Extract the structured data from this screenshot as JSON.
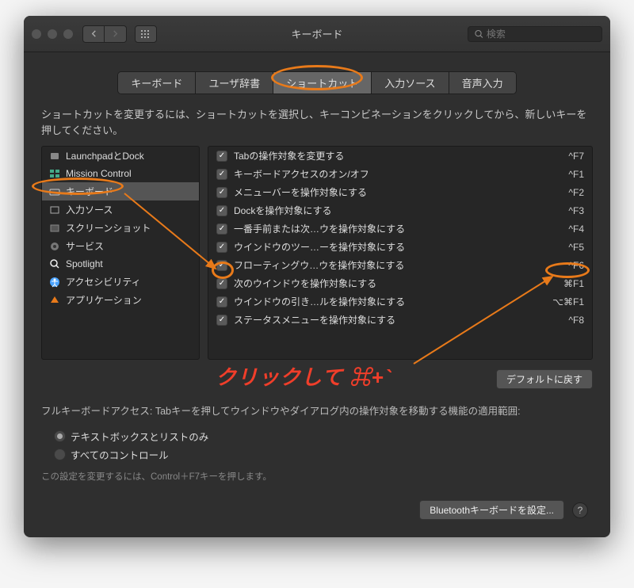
{
  "header": {
    "title": "キーボード",
    "search_placeholder": "検索"
  },
  "tabs": [
    {
      "label": "キーボード",
      "active": false
    },
    {
      "label": "ユーザ辞書",
      "active": false
    },
    {
      "label": "ショートカット",
      "active": true
    },
    {
      "label": "入力ソース",
      "active": false
    },
    {
      "label": "音声入力",
      "active": false
    }
  ],
  "instructions": "ショートカットを変更するには、ショートカットを選択し、キーコンビネーションをクリックしてから、新しいキーを押してください。",
  "categories": [
    {
      "label": "LaunchpadとDock",
      "icon": "rocket",
      "color": "#888"
    },
    {
      "label": "Mission Control",
      "icon": "mc",
      "color": "#5aa"
    },
    {
      "label": "キーボード",
      "icon": "keyboard",
      "color": "#ccc",
      "selected": true
    },
    {
      "label": "入力ソース",
      "icon": "input",
      "color": "#ccc"
    },
    {
      "label": "スクリーンショット",
      "icon": "screenshot",
      "color": "#888"
    },
    {
      "label": "サービス",
      "icon": "gear",
      "color": "#888"
    },
    {
      "label": "Spotlight",
      "icon": "spotlight",
      "color": "#eee"
    },
    {
      "label": "アクセシビリティ",
      "icon": "accessibility",
      "color": "#4aa3ff"
    },
    {
      "label": "アプリケーション",
      "icon": "app",
      "color": "#e87a1a"
    }
  ],
  "shortcuts": [
    {
      "checked": true,
      "label": "Tabの操作対象を変更する",
      "key": "^F7"
    },
    {
      "checked": true,
      "label": "キーボードアクセスのオン/オフ",
      "key": "^F1"
    },
    {
      "checked": true,
      "label": "メニューバーを操作対象にする",
      "key": "^F2"
    },
    {
      "checked": true,
      "label": "Dockを操作対象にする",
      "key": "^F3"
    },
    {
      "checked": true,
      "label": "一番手前または次…ウを操作対象にする",
      "key": "^F4"
    },
    {
      "checked": true,
      "label": "ウインドウのツー…ーを操作対象にする",
      "key": "^F5"
    },
    {
      "checked": true,
      "label": "フローティングウ…ウを操作対象にする",
      "key": "^F6"
    },
    {
      "checked": true,
      "label": "次のウインドウを操作対象にする",
      "key": "⌘F1",
      "highlight": true
    },
    {
      "checked": true,
      "label": "ウインドウの引き…ルを操作対象にする",
      "key": "⌥⌘F1"
    },
    {
      "checked": true,
      "label": "ステータスメニューを操作対象にする",
      "key": "^F8"
    }
  ],
  "restore_defaults_label": "デフォルトに戻す",
  "full_access_text": "フルキーボードアクセス: Tabキーを押してウインドウやダイアログ内の操作対象を移動する機能の適用範囲:",
  "radio_options": [
    {
      "label": "テキストボックスとリストのみ",
      "checked": true
    },
    {
      "label": "すべてのコントロール",
      "checked": false
    }
  ],
  "fine_print": "この設定を変更するには、Control＋F7キーを押します。",
  "bluetooth_label": "Bluetoothキーボードを設定...",
  "annotation_text": "クリックして ⌘+`"
}
